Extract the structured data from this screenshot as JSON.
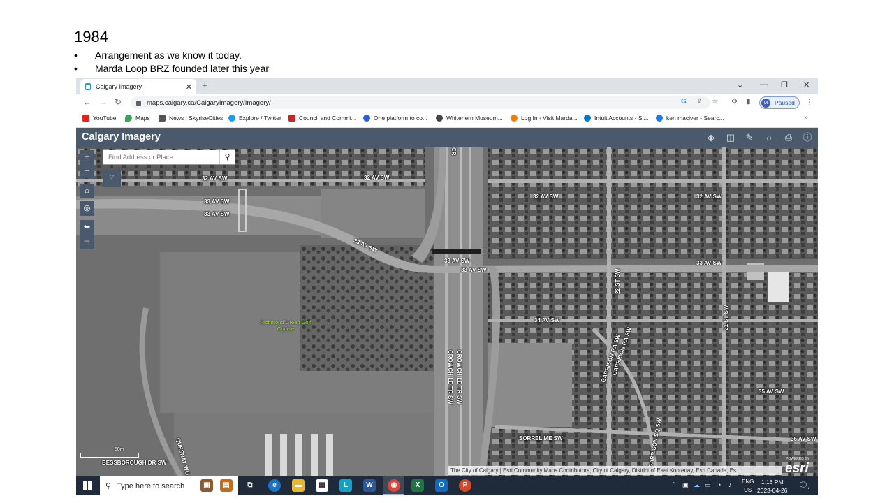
{
  "slide": {
    "title": "1984",
    "bullets": [
      "Arrangement as we know it today.",
      "Marda Loop BRZ founded later this year"
    ]
  },
  "browser": {
    "tab_title": "Calgary Imagery",
    "url": "maps.calgary.ca/CalgaryImagery/Imagery/",
    "profile_initial": "M",
    "profile_status": "Paused",
    "bookmarks": [
      {
        "label": "YouTube",
        "color": "#e62117"
      },
      {
        "label": "Maps",
        "color": "#34a853"
      },
      {
        "label": "News | SkyriseCities",
        "color": "#555555"
      },
      {
        "label": "Explore / Twitter",
        "color": "#1d9bf0"
      },
      {
        "label": "Council and Commi...",
        "color": "#c62828"
      },
      {
        "label": "One platform to co...",
        "color": "#2d5be3"
      },
      {
        "label": "Whitehern Museum...",
        "color": "#444444"
      },
      {
        "label": "Log In ‹ Visit Marda...",
        "color": "#f57c00"
      },
      {
        "label": "Intuit Accounts - Si...",
        "color": "#0077c5"
      },
      {
        "label": "ken maciver - Searc...",
        "color": "#1877f2"
      }
    ],
    "bookmarks_more": "»"
  },
  "app": {
    "title": "Calgary Imagery",
    "tools": [
      "layers-icon",
      "compare-icon",
      "measure-icon",
      "education-icon",
      "print-icon",
      "info-icon"
    ],
    "search_placeholder": "Find Address or Place"
  },
  "map": {
    "labels": [
      {
        "text": "32 AV SW"
      },
      {
        "text": "32 AV SW"
      },
      {
        "text": "33 AV SW"
      },
      {
        "text": "33 AV SW"
      },
      {
        "text": "32 AV SW"
      },
      {
        "text": "32 AV SW"
      },
      {
        "text": "33 AV SW"
      },
      {
        "text": "33 AV SW"
      },
      {
        "text": "33 AV SW"
      },
      {
        "text": "33 AV SW"
      },
      {
        "text": "34 AV SW"
      },
      {
        "text": "35 AV SW"
      },
      {
        "text": "36 AV SW"
      },
      {
        "text": "SORREL ME SW"
      },
      {
        "text": "BESSBOROUGH DR SW"
      },
      {
        "text": "CROWCHILD TR SW"
      },
      {
        "text": "CROWCHILD TR SW"
      },
      {
        "text": "22 ST SW"
      },
      {
        "text": "21 ST SW"
      },
      {
        "text": "GARRISON GA SW"
      },
      {
        "text": "GARRISON GA SW"
      },
      {
        "text": "GARRISON SQ SW"
      },
      {
        "text": "QUESNAY WO"
      },
      {
        "text": "CR"
      }
    ],
    "golf_course": "Richmond Green Golf Course",
    "scale": "60m",
    "attribution": "The City of Calgary | Esri Community Maps Contributors, City of Calgary, District of East Kootenay, Esri Canada, Es...",
    "esri_powered": "POWERED BY",
    "esri": "esri"
  },
  "taskbar": {
    "search": "Type here to search",
    "lang": "ENG",
    "region": "US",
    "time": "1:16 PM",
    "date": "2023-04-26",
    "notifications": "7"
  }
}
